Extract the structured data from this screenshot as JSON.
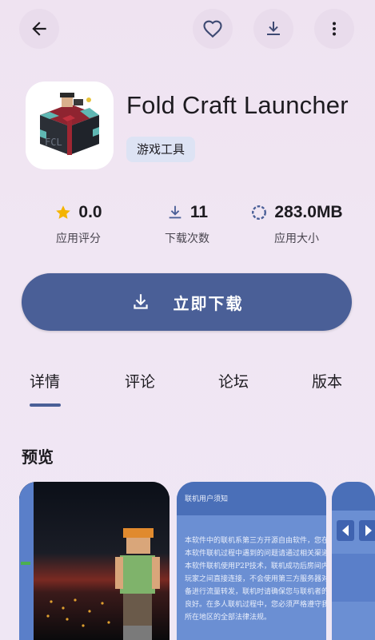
{
  "header": {
    "back_icon": "arrow-left-icon",
    "favorite_icon": "heart-outline-icon",
    "download_icon": "download-icon",
    "more_icon": "more-vert-icon"
  },
  "app": {
    "name": "Fold Craft Launcher",
    "category": "游戏工具"
  },
  "stats": {
    "rating": {
      "value": "0.0",
      "label": "应用评分"
    },
    "downloads": {
      "value": "11",
      "label": "下载次数"
    },
    "size": {
      "value": "283.0MB",
      "label": "应用大小"
    }
  },
  "download_button": {
    "label": "立即下载"
  },
  "tabs": [
    "详情",
    "评论",
    "论坛",
    "版本"
  ],
  "active_tab": "详情",
  "preview": {
    "title": "预览",
    "shot2_lines": [
      "联机用户须知",
      "本软件中的联机系第三方开源自由软件，您在使用",
      "本软件联机过程中遇到的问题请通过相关渠道进行反馈，",
      "本软件联机使用P2P技术，联机成功后房间内",
      "玩家之间直接连接，不会使用第三方服务器对您的设",
      "备进行流量转发，联机时请确保您与联机者的网络情况",
      "良好。在多人联机过程中，您必须严格遵守我国",
      "所在地区的全部法律法规。"
    ]
  },
  "colors": {
    "accent": "#4a5f97",
    "star": "#f4b400",
    "chip_bg": "#dde3f4"
  }
}
